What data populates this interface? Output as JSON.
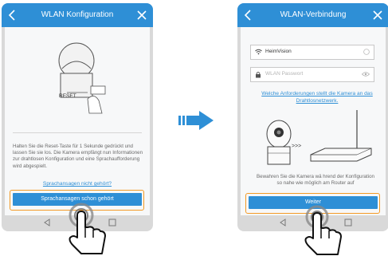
{
  "screen_left": {
    "title": "WLAN Konfiguration",
    "camera_button_label": "RESET",
    "instructions": "Halten Sie die Reset-Taste für 1 Sekunde gedrückt und lassen Sie sie los. Die Kamera empfängt nun Informationen zur drahtlosen Konfiguration und eine Sprachaufforderung wird abgespielt.",
    "link_not_heard": "Sprachansagen nicht gehört?",
    "button_heard": "Sprachansagen schon gehört"
  },
  "screen_right": {
    "title": "WLAN-Verbindung",
    "ssid_value": "HeimVision",
    "password_placeholder": "WLAN Passwort",
    "link_requirements": "Welche Anforderungen stellt die Kamera an das Drahtlosnetzwerk.",
    "dots": ">>>",
    "hint": "Bewahren Sie die Kamera wä hrend der Konfiguration so nahe wie möglich am Router auf",
    "button_next": "Weiter"
  },
  "colors": {
    "accent": "#2e8fd6",
    "highlight": "#f39a25",
    "phone_frame": "#d9d9d9"
  },
  "icons": [
    "back-chevron-icon",
    "close-icon",
    "wifi-icon",
    "lock-icon",
    "eye-icon",
    "clear-icon",
    "nav-back-icon",
    "nav-home-icon",
    "nav-recents-icon",
    "arrow-right-icon",
    "hand-pointer-icon"
  ]
}
